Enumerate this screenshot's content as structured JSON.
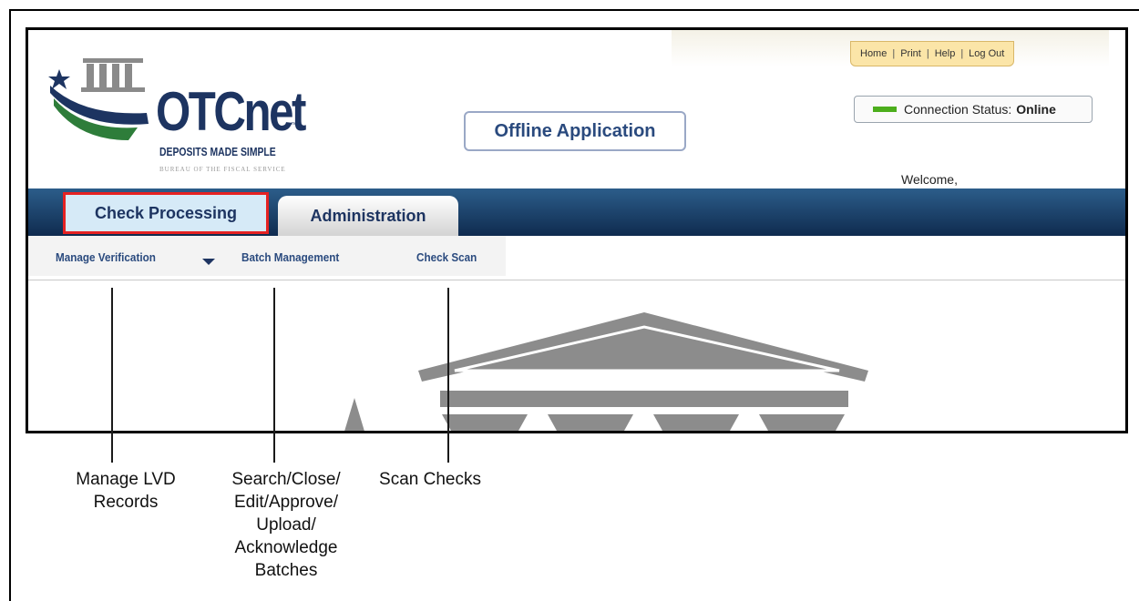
{
  "header": {
    "logo_wordmark": "OTCnet",
    "logo_trademark": "™",
    "logo_tagline": "DEPOSITS MADE SIMPLE",
    "logo_subtag": "BUREAU OF THE FISCAL SERVICE"
  },
  "top_links": [
    "Home",
    "Print",
    "Help",
    "Log Out"
  ],
  "connection_status": {
    "label": "Connection Status:",
    "value": "Online",
    "indicator_color": "#4cae1c"
  },
  "app_badge": "Offline Application",
  "welcome": "Welcome,",
  "tabs": [
    {
      "label": "Check Processing",
      "active": true,
      "highlight_color": "#e52222"
    },
    {
      "label": "Administration",
      "active": false
    }
  ],
  "subnav": [
    {
      "label": "Manage Verification",
      "has_dropdown": true
    },
    {
      "label": "Batch Management"
    },
    {
      "label": "Check Scan"
    }
  ],
  "callouts": [
    "Manage  LVD\nRecords",
    "Search/Close/\nEdit/Approve/\nUpload/\nAcknowledge\nBatches",
    "Scan Checks"
  ],
  "colors": {
    "nav_bar": "#1a3f6b",
    "brand": "#1d3461",
    "link_bar": "#fbe5a8"
  }
}
